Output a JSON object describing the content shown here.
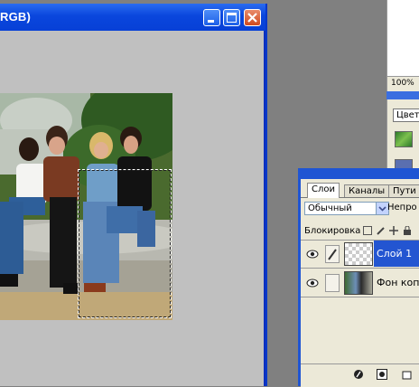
{
  "document_window": {
    "title": "RGB)"
  },
  "navigator": {
    "zoom": "100%"
  },
  "swatches_panel": {
    "tab_label": "Цвет",
    "swatch_colors": [
      "#3a8a3a",
      "#5a6fb0"
    ]
  },
  "layers_panel": {
    "tabs": [
      {
        "label": "Слои",
        "active": true
      },
      {
        "label": "Каналы",
        "active": false
      },
      {
        "label": "Пути",
        "active": false
      }
    ],
    "blend_mode": "Обычный",
    "opacity_label": "Непро",
    "lock_label": "Блокировка",
    "layers": [
      {
        "name": "Слой 1",
        "selected": true,
        "visible": true
      },
      {
        "name": "Фон копия",
        "selected": false,
        "visible": true
      }
    ]
  },
  "colors": {
    "titlebar_blue": "#0a46dd",
    "selection_blue": "#2355d1",
    "panel_bg": "#ece9d8"
  }
}
